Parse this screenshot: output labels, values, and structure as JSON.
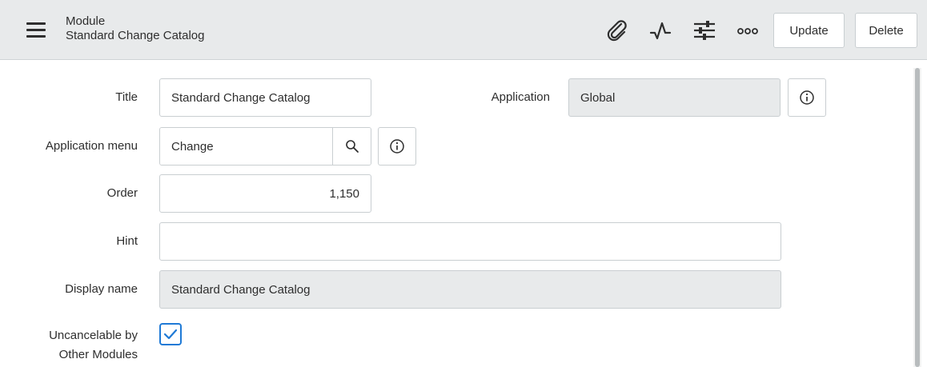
{
  "header": {
    "title": "Module",
    "subtitle": "Standard Change Catalog",
    "icons": [
      "attachment-icon",
      "activity-icon",
      "settings-icon",
      "more-options-icon"
    ],
    "update_label": "Update",
    "delete_label": "Delete"
  },
  "form": {
    "title": {
      "label": "Title",
      "value": "Standard Change Catalog"
    },
    "application": {
      "label": "Application",
      "value": "Global"
    },
    "application_menu": {
      "label": "Application menu",
      "value": "Change"
    },
    "order": {
      "label": "Order",
      "value": "1,150"
    },
    "hint": {
      "label": "Hint",
      "value": ""
    },
    "display_name": {
      "label": "Display name",
      "value": "Standard Change Catalog"
    },
    "uncancelable": {
      "label_line1": "Uncancelable by",
      "label_line2": "Other Modules",
      "checked": true
    }
  },
  "colors": {
    "header_bg": "#e8eaeb",
    "readonly_bg": "#e8eaeb",
    "checkbox_accent": "#1f7ad6"
  }
}
